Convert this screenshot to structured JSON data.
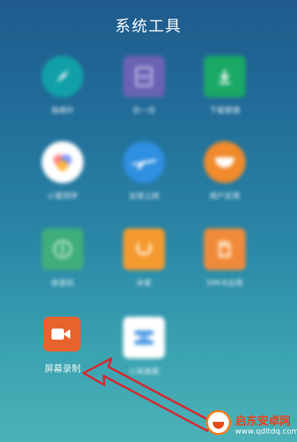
{
  "header": {
    "title": "系统工具"
  },
  "apps": [
    {
      "label": "指南针",
      "icon": "compass-icon",
      "color": "#12a0a8"
    },
    {
      "label": "日一日",
      "icon": "calendar-icon",
      "color": "#6a62b3"
    },
    {
      "label": "下载管理",
      "icon": "download-icon",
      "color": "#1aa865"
    },
    {
      "label": "小爱同学",
      "icon": "assistant-icon",
      "color": "#ffffff"
    },
    {
      "label": "全球上网",
      "icon": "airplane-icon",
      "color": "#2f8fe0"
    },
    {
      "label": "用户反馈",
      "icon": "feedback-icon",
      "color": "#f08a2b"
    },
    {
      "label": "收音机",
      "icon": "radio-icon",
      "color": "#3fae79"
    },
    {
      "label": "米家",
      "icon": "smile-icon",
      "color": "#f59a2e"
    },
    {
      "label": "SIM卡应用",
      "icon": "sim-icon",
      "color": "#f08a3a"
    },
    {
      "label": "屏幕录制",
      "icon": "video-camera-icon",
      "color": "#e8622e"
    },
    {
      "label": "小米画报",
      "icon": "wallpaper-icon",
      "color": "#ffffff"
    }
  ],
  "watermark": {
    "name": "启东安卓网",
    "url": "www.qdltdq.com"
  }
}
